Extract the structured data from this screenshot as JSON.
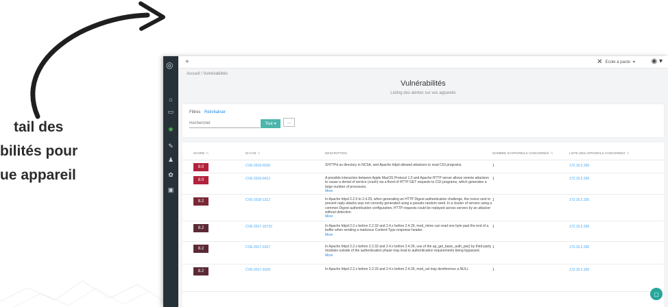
{
  "promo": {
    "line1": "tail des",
    "line2": "bilités pour",
    "line3": "ue appareil"
  },
  "topbar": {
    "add_label": "+",
    "org_name": "Ecole à pacte",
    "user_icon": "user-circle-icon"
  },
  "breadcrumb": "Accueil / Vulnérabilités",
  "page": {
    "title": "Vulnérabilités",
    "subtitle": "Listing des alertes sur vos appareils"
  },
  "filters": {
    "label": "Filtres",
    "reset": "Réinitialiser",
    "search_placeholder": "Rechercher",
    "select_value": "Tout",
    "extra_button": "..."
  },
  "table": {
    "headers": [
      "SCORE",
      "ID CVE",
      "DESCRIPTION",
      "NOMBRE D'APPAREILS CONCERNÉS",
      "LISTE DES APPAREILS CONCERNÉS"
    ],
    "more_label": "More",
    "rows": [
      {
        "score": "8.0",
        "color": "#b3223c",
        "cve": "CVE-2019-0230",
        "desc": "SHTTPd as directory in NCSA, and Apache httpd allowed attackers to read CGI programs.",
        "more": false,
        "count": "1",
        "ips": "172.19.2.330"
      },
      {
        "score": "8.0",
        "color": "#b3223c",
        "cve": "CVE-2019-0412",
        "desc": "A possible interaction between Apple MacOS Protocol 1.0 and Apache HTTP server allows remote attackers to cause a denial of service (crash) via a flood of HTTP GET requests to CGI programs, which generates a large number of processes.",
        "more": true,
        "count": "1",
        "ips": "172.19.2.330"
      },
      {
        "score": "8.2",
        "color": "#7b2737",
        "cve": "CVE-2018-1312",
        "desc": "In Apache httpd 2.2.0 to 2.4.29, when generating an HTTP Digest authentication challenge, the nonce sent to prevent reply attacks was not correctly generated using a pseudo-random seed. In a cluster of servers using a common Digest authentication configuration, HTTP requests could be replayed across servers by an attacker without detection.",
        "more": true,
        "count": "1",
        "ips": "172.19.2.330"
      },
      {
        "score": "8.2",
        "color": "#5b2a35",
        "cve": "CVE-2017-15710",
        "desc": "In Apache httpd 2.2.x before 2.2.33 and 2.4.x before 2.4.26, mod_mime can read one byte past the end of a buffer when sending a malicious Content-Type response header.",
        "more": true,
        "count": "1",
        "ips": "172.19.2.330"
      },
      {
        "score": "8.2",
        "color": "#5b2a35",
        "cve": "CVE-2017-3167",
        "desc": "In Apache httpd 2.2.x before 2.2.33 and 2.4.x before 2.4.26, use of the ap_get_basic_auth_pw() by third-party modules outside of the authentication phase may lead to authentication requirements being bypassed.",
        "more": true,
        "count": "1",
        "ips": "172.19.2.330"
      },
      {
        "score": "8.2",
        "color": "#5b2a35",
        "cve": "CVE-2017-3169",
        "desc": "In Apache httpd 2.2.x before 2.2.33 and 2.4.x before 2.4.26, mod_ssl may dereference a NULL",
        "more": false,
        "count": "1",
        "ips": "172.19.2.330"
      }
    ]
  },
  "sidebar": {
    "icons": [
      "home-icon",
      "devices-icon",
      "bug-icon",
      "tools-icon",
      "users-icon",
      "settings-icon",
      "gift-icon"
    ]
  },
  "colors": {
    "sidebar": "#263238",
    "accent": "#4db6ac",
    "link": "#42a5f5"
  }
}
